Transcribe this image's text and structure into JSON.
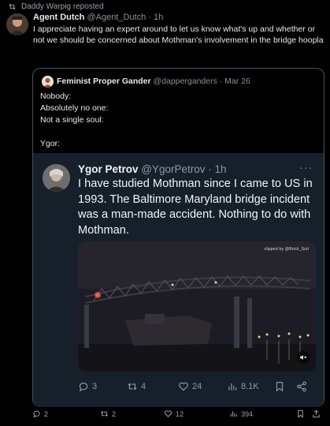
{
  "repost": {
    "label": "Daddy Warpig reposted"
  },
  "post": {
    "author_name": "Agent Dutch",
    "author_handle": "@Agent_Dutch",
    "time": "· 1h",
    "text": "I appreciate having an expert around to let us know what's up and whether or not we should be concerned about Mothman's involvement in the bridge hoopla",
    "actions": {
      "replies": "2",
      "reposts": "2",
      "likes": "12",
      "views": "394"
    }
  },
  "quote": {
    "author_name": "Feminist Proper Gander",
    "author_meta": "@dapperganders · Mar 26",
    "lines": [
      "Nobody:",
      "Absolutely no one:",
      "Not a single soul:",
      "",
      "Ygor:"
    ]
  },
  "inner": {
    "author_name": "Ygor Petrov",
    "author_meta": "@YgorPetrov · 1h",
    "more": "···",
    "text": "I have studied Mothman since I came to US in 1993. The Baltimore Maryland bridge incident was a man-made accident. Nothing to do with Mothman.",
    "video_credit": "clipped by @Brick_Suit",
    "actions": {
      "replies": "3",
      "reposts": "4",
      "likes": "24",
      "views": "8.1K"
    }
  },
  "colors": {
    "background": "#000000",
    "inner_card": "#15202b",
    "text": "#e7e9ea",
    "muted": "#8b98a5"
  }
}
